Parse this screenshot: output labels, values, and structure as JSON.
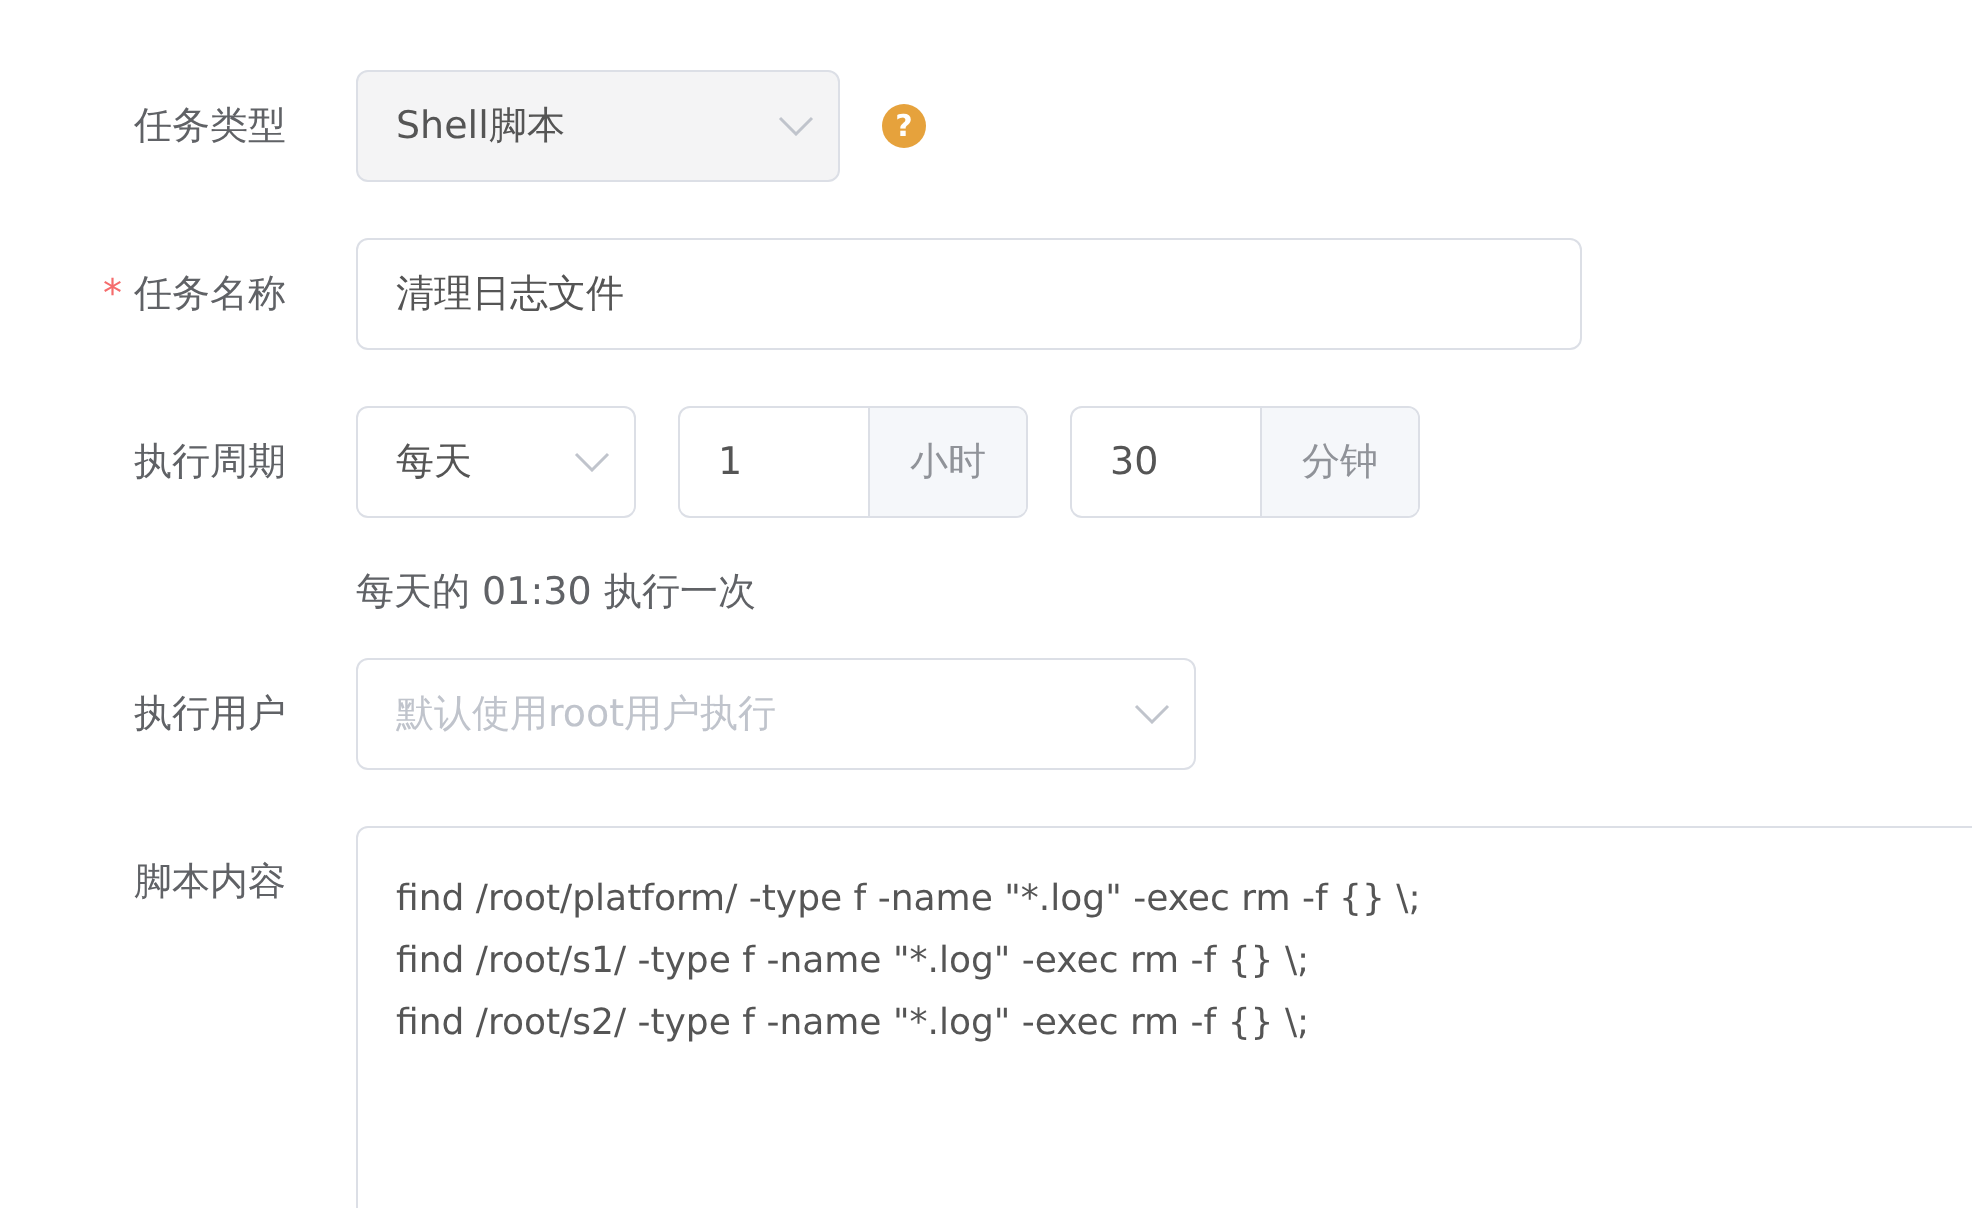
{
  "fields": [
    {
      "kind": "readonly-select",
      "label": "任务类型",
      "value": "Shell脚本",
      "help_icon": "?"
    },
    {
      "kind": "text",
      "label": "任务名称",
      "required_mark": "*",
      "value": "清理日志文件"
    },
    {
      "kind": "schedule",
      "label": "执行周期",
      "frequency": "每天",
      "hour": {
        "value": "1",
        "unit": "小时"
      },
      "minute": {
        "value": "30",
        "unit": "分钟"
      },
      "summary": "每天的 01:30 执行一次"
    },
    {
      "kind": "select",
      "label": "执行用户",
      "placeholder": "默认使用root用户执行"
    },
    {
      "kind": "textarea",
      "label": "脚本内容",
      "lines": [
        "find /root/platform/ -type f -name \"*.log\" -exec rm -f {} \\;",
        "find /root/s1/ -type f -name \"*.log\" -exec rm -f {} \\;",
        "find /root/s2/ -type f -name \"*.log\" -exec rm -f {} \\;"
      ]
    }
  ]
}
